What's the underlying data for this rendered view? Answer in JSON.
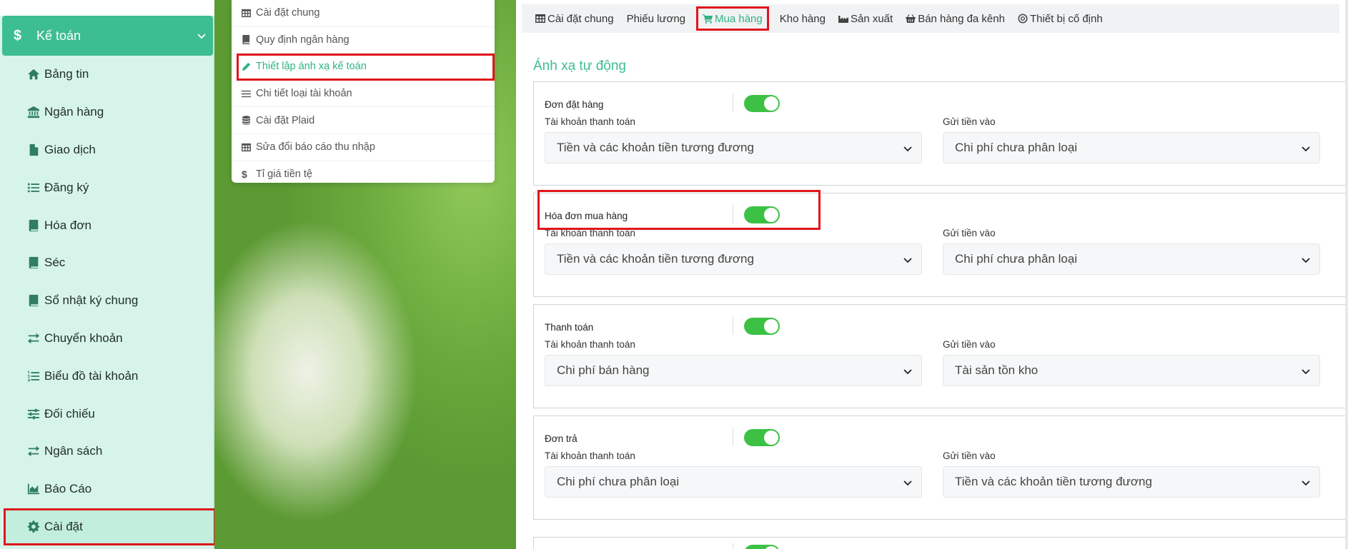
{
  "sidebar": {
    "header": {
      "label": "Kế toán"
    },
    "items": [
      {
        "label": "Bảng tin",
        "icon": "home-icon"
      },
      {
        "label": "Ngân hàng",
        "icon": "bank-icon"
      },
      {
        "label": "Giao dịch",
        "icon": "file-icon"
      },
      {
        "label": "Đăng ký",
        "icon": "list-icon"
      },
      {
        "label": "Hóa đơn",
        "icon": "book-icon"
      },
      {
        "label": "Séc",
        "icon": "book-icon"
      },
      {
        "label": "Sổ nhật ký chung",
        "icon": "book-icon"
      },
      {
        "label": "Chuyển khoản",
        "icon": "exchange-icon"
      },
      {
        "label": "Biểu đồ tài khoản",
        "icon": "ordered-list-icon"
      },
      {
        "label": "Đối chiếu",
        "icon": "sliders-icon"
      },
      {
        "label": "Ngân sách",
        "icon": "exchange-icon"
      },
      {
        "label": "Báo Cáo",
        "icon": "area-chart-icon"
      },
      {
        "label": "Cài đặt",
        "icon": "gear-icon"
      }
    ]
  },
  "settings_menu": {
    "items": [
      {
        "label": "Cài đặt chung",
        "icon": "table-icon"
      },
      {
        "label": "Quy định ngân hàng",
        "icon": "book-icon"
      },
      {
        "label": "Thiết lập ánh xạ kế toán",
        "icon": "pencil-icon"
      },
      {
        "label": "Chi tiết loại tài khoản",
        "icon": "bars-icon"
      },
      {
        "label": "Cài đặt Plaid",
        "icon": "database-icon"
      },
      {
        "label": "Sửa đổi báo cáo thu nhập",
        "icon": "table-icon"
      },
      {
        "label": "Tỉ giá tiền tệ",
        "icon": "dollar-icon"
      }
    ]
  },
  "tabs": [
    {
      "label": "Cài đặt chung",
      "icon": "table-icon"
    },
    {
      "label": "Phiếu lương",
      "icon": ""
    },
    {
      "label": "Mua hàng",
      "icon": "cart-icon"
    },
    {
      "label": "Kho hàng",
      "icon": ""
    },
    {
      "label": "Sản xuất",
      "icon": "industry-icon"
    },
    {
      "label": "Bán hàng đa kênh",
      "icon": "basket-icon"
    },
    {
      "label": "Thiết bị cố định",
      "icon": "target-icon"
    }
  ],
  "main": {
    "section_title": "Ánh xạ tự động",
    "cards": [
      {
        "name": "Đơn đặt hàng",
        "enabled": true,
        "payment_label": "Tài khoản thanh toán",
        "payment_value": "Tiền và các khoản tiền tương đương",
        "deposit_label": "Gửi tiền vào",
        "deposit_value": "Chi phí chưa phân loại"
      },
      {
        "name": "Hóa đơn mua hàng",
        "enabled": true,
        "payment_label": "Tài khoản thanh toán",
        "payment_value": "Tiền và các khoản tiền tương đương",
        "deposit_label": "Gửi tiền vào",
        "deposit_value": "Chi phí chưa phân loại"
      },
      {
        "name": "Thanh toán",
        "enabled": true,
        "payment_label": "Tài khoản thanh toán",
        "payment_value": "Chi phí bán hàng",
        "deposit_label": "Gửi tiền vào",
        "deposit_value": "Tài sản tồn kho"
      },
      {
        "name": "Đơn trả",
        "enabled": true,
        "payment_label": "Tài khoản thanh toán",
        "payment_value": "Chi phí chưa phân loại",
        "deposit_label": "Gửi tiền vào",
        "deposit_value": "Tiền và các khoản tiền tương đương"
      }
    ]
  },
  "colors": {
    "accent": "#3dbd92",
    "sidebar_bg": "#d7f4ea",
    "highlight": "#e0161b",
    "toggle_on": "#3cc144"
  }
}
